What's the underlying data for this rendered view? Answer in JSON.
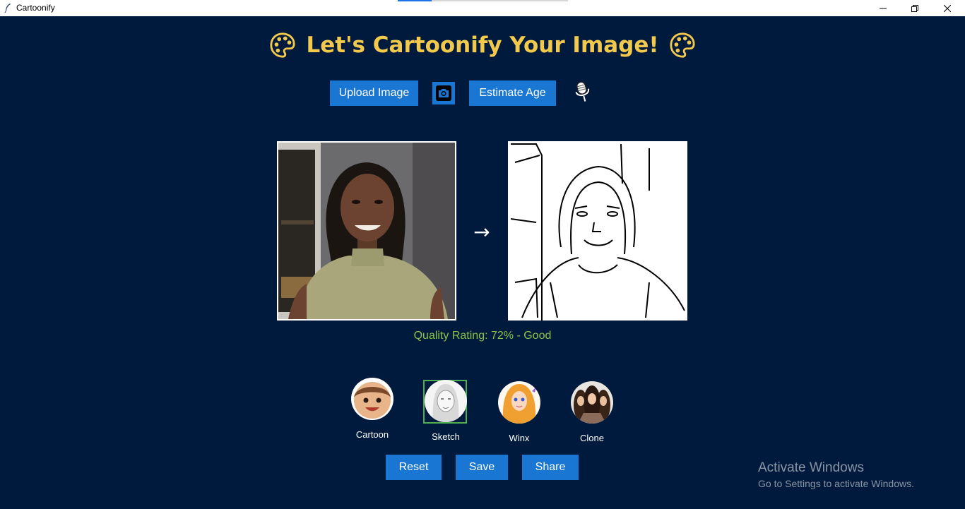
{
  "window": {
    "title": "Cartoonify",
    "app_icon": "feather-icon",
    "controls": [
      "minimize-icon",
      "restore-icon",
      "close-icon"
    ]
  },
  "heading": {
    "text": "Let's Cartoonify Your Image!",
    "icon": "palette-icon",
    "color": "#f2c94c"
  },
  "toolbar": {
    "upload_label": "Upload Image",
    "camera_icon": "camera-icon",
    "estimate_label": "Estimate Age",
    "mic_icon": "microphone-icon"
  },
  "preview": {
    "arrow": "→",
    "original_icon": "original-photo",
    "result_icon": "sketch-result"
  },
  "quality": {
    "text": "Quality Rating: 72% - Good",
    "color": "#8bc34a"
  },
  "styles": [
    {
      "label": "Cartoon",
      "icon": "cartoon-avatar"
    },
    {
      "label": "Sketch",
      "icon": "sketch-avatar",
      "selected": true
    },
    {
      "label": "Winx",
      "icon": "winx-avatar"
    },
    {
      "label": "Clone",
      "icon": "clone-avatar"
    }
  ],
  "actions": {
    "reset_label": "Reset",
    "save_label": "Save",
    "share_label": "Share"
  },
  "watermark": {
    "title": "Activate Windows",
    "subtitle": "Go to Settings to activate Windows."
  },
  "colors": {
    "background": "#001a3d",
    "button": "#1976d2",
    "selection": "#4caf50"
  }
}
